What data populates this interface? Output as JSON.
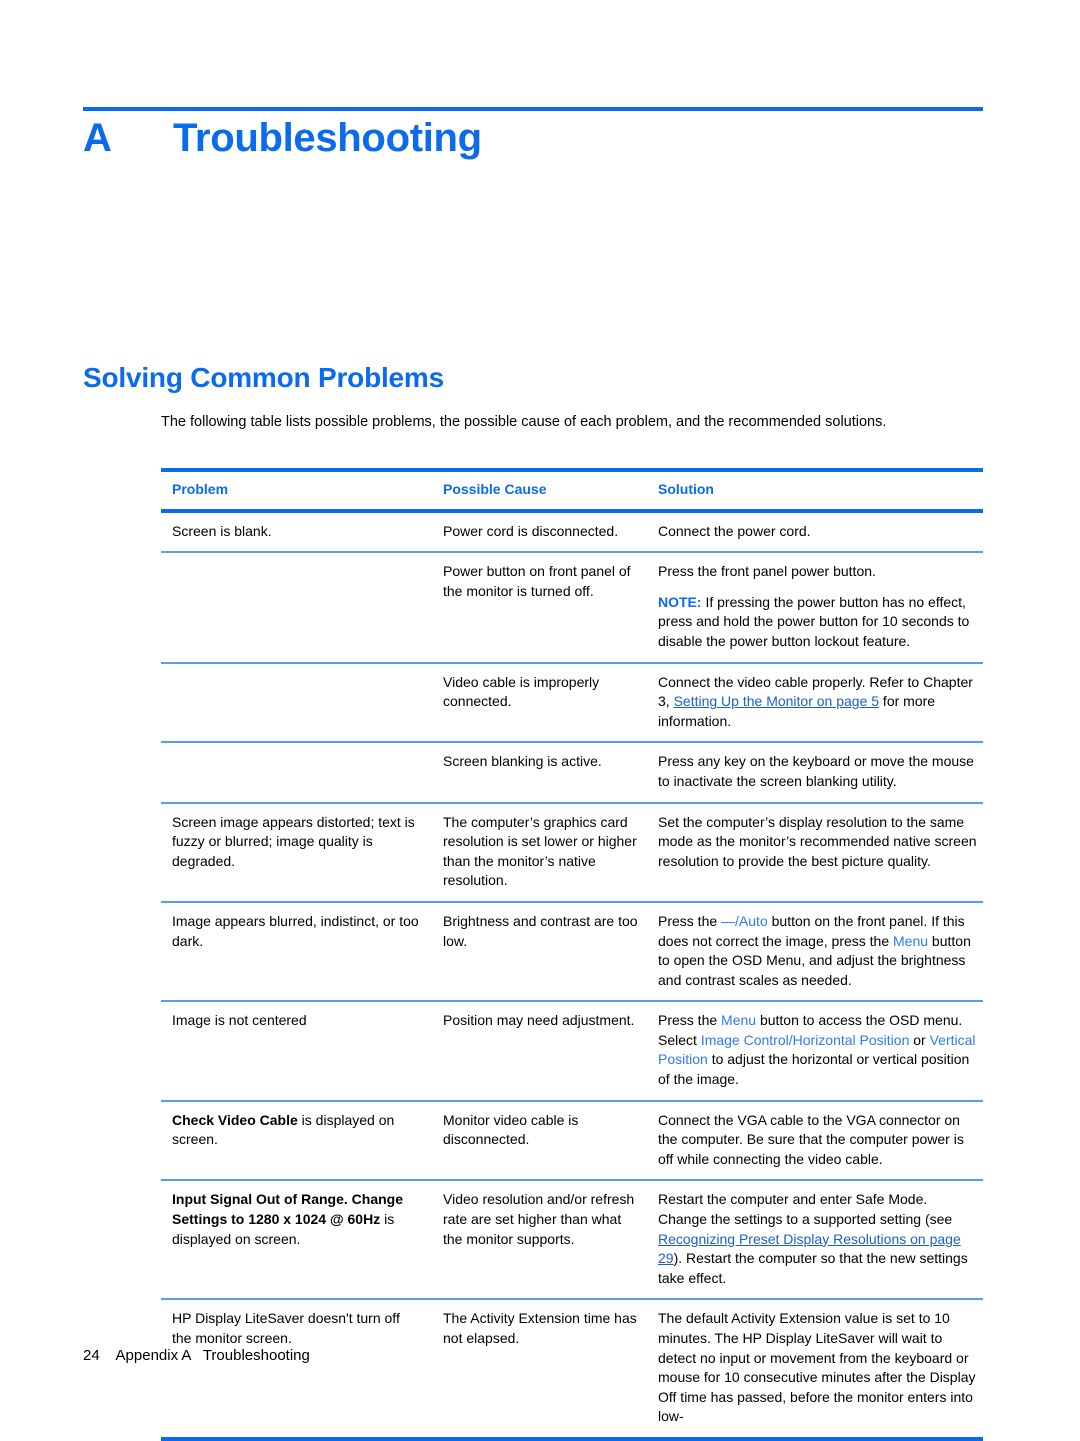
{
  "chapter": {
    "letter": "A",
    "title": "Troubleshooting"
  },
  "section": {
    "title": "Solving Common Problems",
    "intro": "The following table lists possible problems, the possible cause of each problem, and the recommended solutions."
  },
  "table": {
    "headers": {
      "problem": "Problem",
      "possible_cause": "Possible Cause",
      "solution": "Solution"
    },
    "rows": [
      {
        "problem": "Screen is blank.",
        "cause": "Power cord is disconnected.",
        "solution": "Connect the power cord."
      },
      {
        "problem": "",
        "cause": "Power button on front panel of the monitor is turned off.",
        "solution": "Press the front panel power button.",
        "note_label": "NOTE:",
        "note_text": "If pressing the power button has no effect, press and hold the power button for 10 seconds to disable the power button lockout feature."
      },
      {
        "problem": "",
        "cause": "Video cable is improperly connected.",
        "solution_pre": "Connect the video cable properly. Refer to Chapter 3, ",
        "solution_link": "Setting Up the Monitor on page 5",
        "solution_post": " for more information."
      },
      {
        "problem": "",
        "cause": "Screen blanking is active.",
        "solution": "Press any key on the keyboard or move the mouse to inactivate the screen blanking utility."
      },
      {
        "problem": "Screen image appears distorted; text is fuzzy or blurred; image quality is degraded.",
        "cause": "The computer’s graphics card resolution is set lower or higher than the monitor’s native resolution.",
        "solution": "Set the computer’s display resolution to the same mode as the monitor’s recommended native screen resolution to provide the best picture quality."
      },
      {
        "problem": "Image appears blurred, indistinct, or too dark.",
        "cause": "Brightness and contrast are too low.",
        "solution_seg": [
          {
            "t": "Press the ",
            "s": "plain"
          },
          {
            "t": "—/Auto",
            "s": "uiref"
          },
          {
            "t": " button on the front panel. If this does not correct the image, press the ",
            "s": "plain"
          },
          {
            "t": "Menu",
            "s": "uiref"
          },
          {
            "t": " button to open the OSD Menu, and adjust the brightness and contrast scales as needed.",
            "s": "plain"
          }
        ]
      },
      {
        "problem": "Image is not centered",
        "cause": "Position may need adjustment.",
        "solution_seg": [
          {
            "t": "Press the ",
            "s": "plain"
          },
          {
            "t": "Menu",
            "s": "uiref"
          },
          {
            "t": " button to access the OSD menu. Select ",
            "s": "plain"
          },
          {
            "t": "Image Control/Horizontal Position",
            "s": "uiref"
          },
          {
            "t": " or ",
            "s": "plain"
          },
          {
            "t": "Vertical Position",
            "s": "uiref"
          },
          {
            "t": " to adjust the horizontal or vertical position of the image.",
            "s": "plain"
          }
        ]
      },
      {
        "problem_seg": [
          {
            "t": "Check Video Cable",
            "s": "bold"
          },
          {
            "t": " is displayed on screen.",
            "s": "plain"
          }
        ],
        "cause": "Monitor video cable is disconnected.",
        "solution": "Connect the VGA cable to the VGA connector on the computer. Be sure that the computer power is off while connecting the video cable."
      },
      {
        "problem_seg": [
          {
            "t": "Input Signal Out of Range. Change Settings to 1280 x 1024 @ 60Hz",
            "s": "bold"
          },
          {
            "t": " is displayed on screen.",
            "s": "plain"
          }
        ],
        "cause": "Video resolution and/or refresh rate are set higher than what the monitor supports.",
        "solution_seg": [
          {
            "t": "Restart the computer and enter Safe Mode. Change the settings to a supported setting (see ",
            "s": "plain"
          },
          {
            "t": "Recognizing Preset Display Resolutions on page 29",
            "s": "link"
          },
          {
            "t": "). Restart the computer so that the new settings take effect.",
            "s": "plain"
          }
        ]
      },
      {
        "problem": "HP Display LiteSaver doesn't turn off the monitor screen.",
        "cause": "The Activity Extension time has not elapsed.",
        "solution": "The default Activity Extension value is set to 10 minutes. The HP Display LiteSaver will wait to detect no input or movement from the keyboard or mouse for 10 consecutive minutes after the Display Off time has passed, before the monitor enters into low-"
      }
    ]
  },
  "footer": {
    "page_number": "24",
    "text": "Appendix A   Troubleshooting"
  },
  "colors": {
    "accent_blue": "#0B6BEE",
    "rule_light_blue": "#5B9BF5",
    "link_blue": "#1A5FD0",
    "uiref_blue": "#2E7BF0"
  }
}
